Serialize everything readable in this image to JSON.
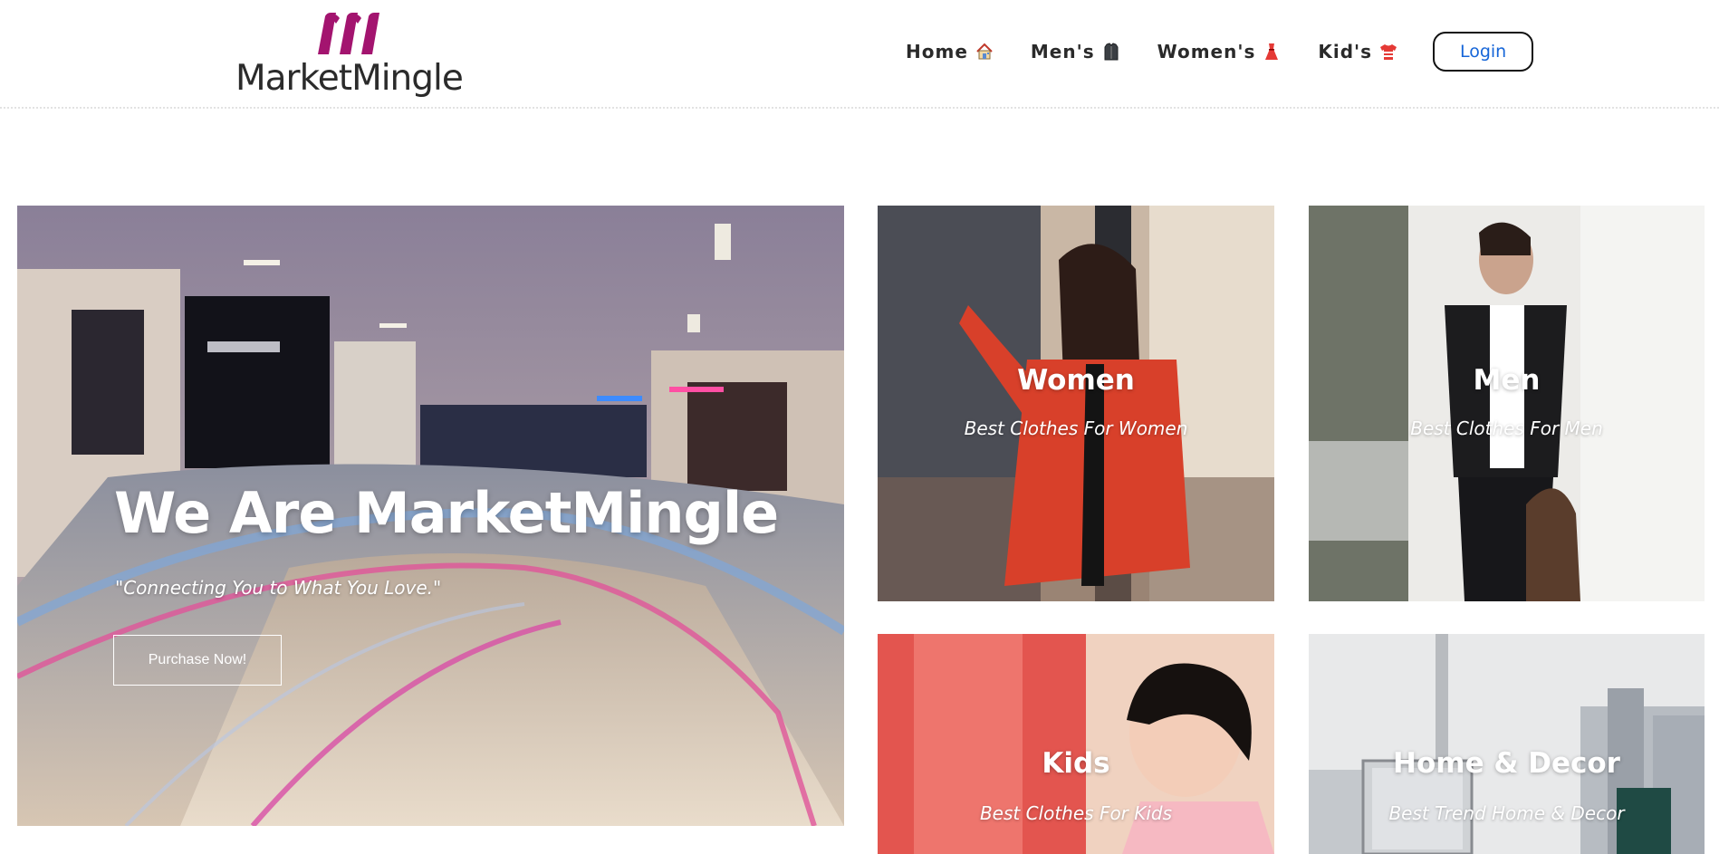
{
  "brand": {
    "name": "MarketMingle",
    "mark_color": "#a3146f"
  },
  "nav": {
    "items": [
      {
        "label": "Home",
        "icon": "house-icon"
      },
      {
        "label": "Men's",
        "icon": "shirt-dark-icon"
      },
      {
        "label": "Women's",
        "icon": "dress-icon"
      },
      {
        "label": "Kid's",
        "icon": "tshirt-icon"
      }
    ],
    "login_label": "Login",
    "login_color": "#1565d8"
  },
  "hero": {
    "title": "We Are MarketMingle",
    "tagline": "\"Connecting You to What You Love.\"",
    "button_label": "Purchase Now!"
  },
  "categories": [
    {
      "title": "Women",
      "subtitle": "Best Clothes For Women"
    },
    {
      "title": "Men",
      "subtitle": "Best Clothes For Men"
    },
    {
      "title": "Kids",
      "subtitle": "Best Clothes For Kids"
    },
    {
      "title": "Home & Decor",
      "subtitle": "Best Trend Home & Decor"
    }
  ]
}
